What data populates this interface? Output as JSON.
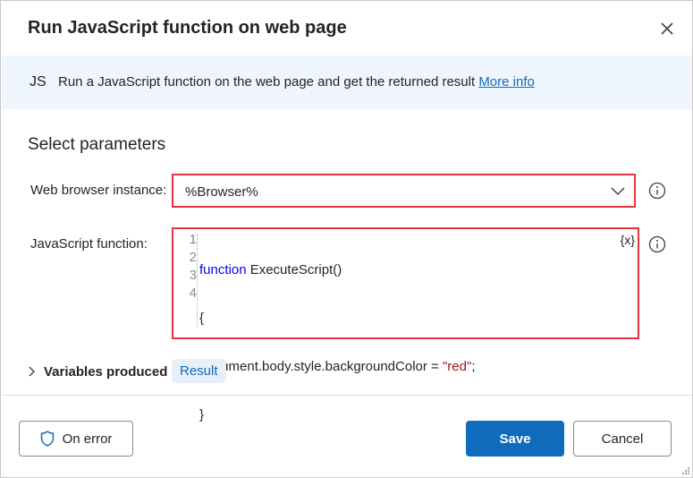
{
  "dialog": {
    "title": "Run JavaScript function on web page",
    "close_icon": "close-icon"
  },
  "banner": {
    "badge": "JS",
    "description": "Run a JavaScript function on the web page and get the returned result",
    "link": "More info"
  },
  "section_title": "Select parameters",
  "browser_instance": {
    "label": "Web browser instance:",
    "value": "%Browser%"
  },
  "js_function": {
    "label": "JavaScript function:",
    "variable_button": "{x}",
    "line_numbers": [
      "1",
      "2",
      "3",
      "4"
    ],
    "code": {
      "l1_keyword": "function",
      "l1_rest": " ExecuteScript()",
      "l2": "{",
      "l3_prefix": "document.body.style.backgroundColor = ",
      "l3_string": "\"red\"",
      "l3_suffix": ";",
      "l4": "}"
    }
  },
  "variables_produced": {
    "label": "Variables produced",
    "chip": "Result"
  },
  "footer": {
    "on_error": "On error",
    "save": "Save",
    "cancel": "Cancel"
  },
  "colors": {
    "accent": "#0f6cbd",
    "highlight_border": "#e3343f",
    "banner_bg": "#eff5fc"
  }
}
